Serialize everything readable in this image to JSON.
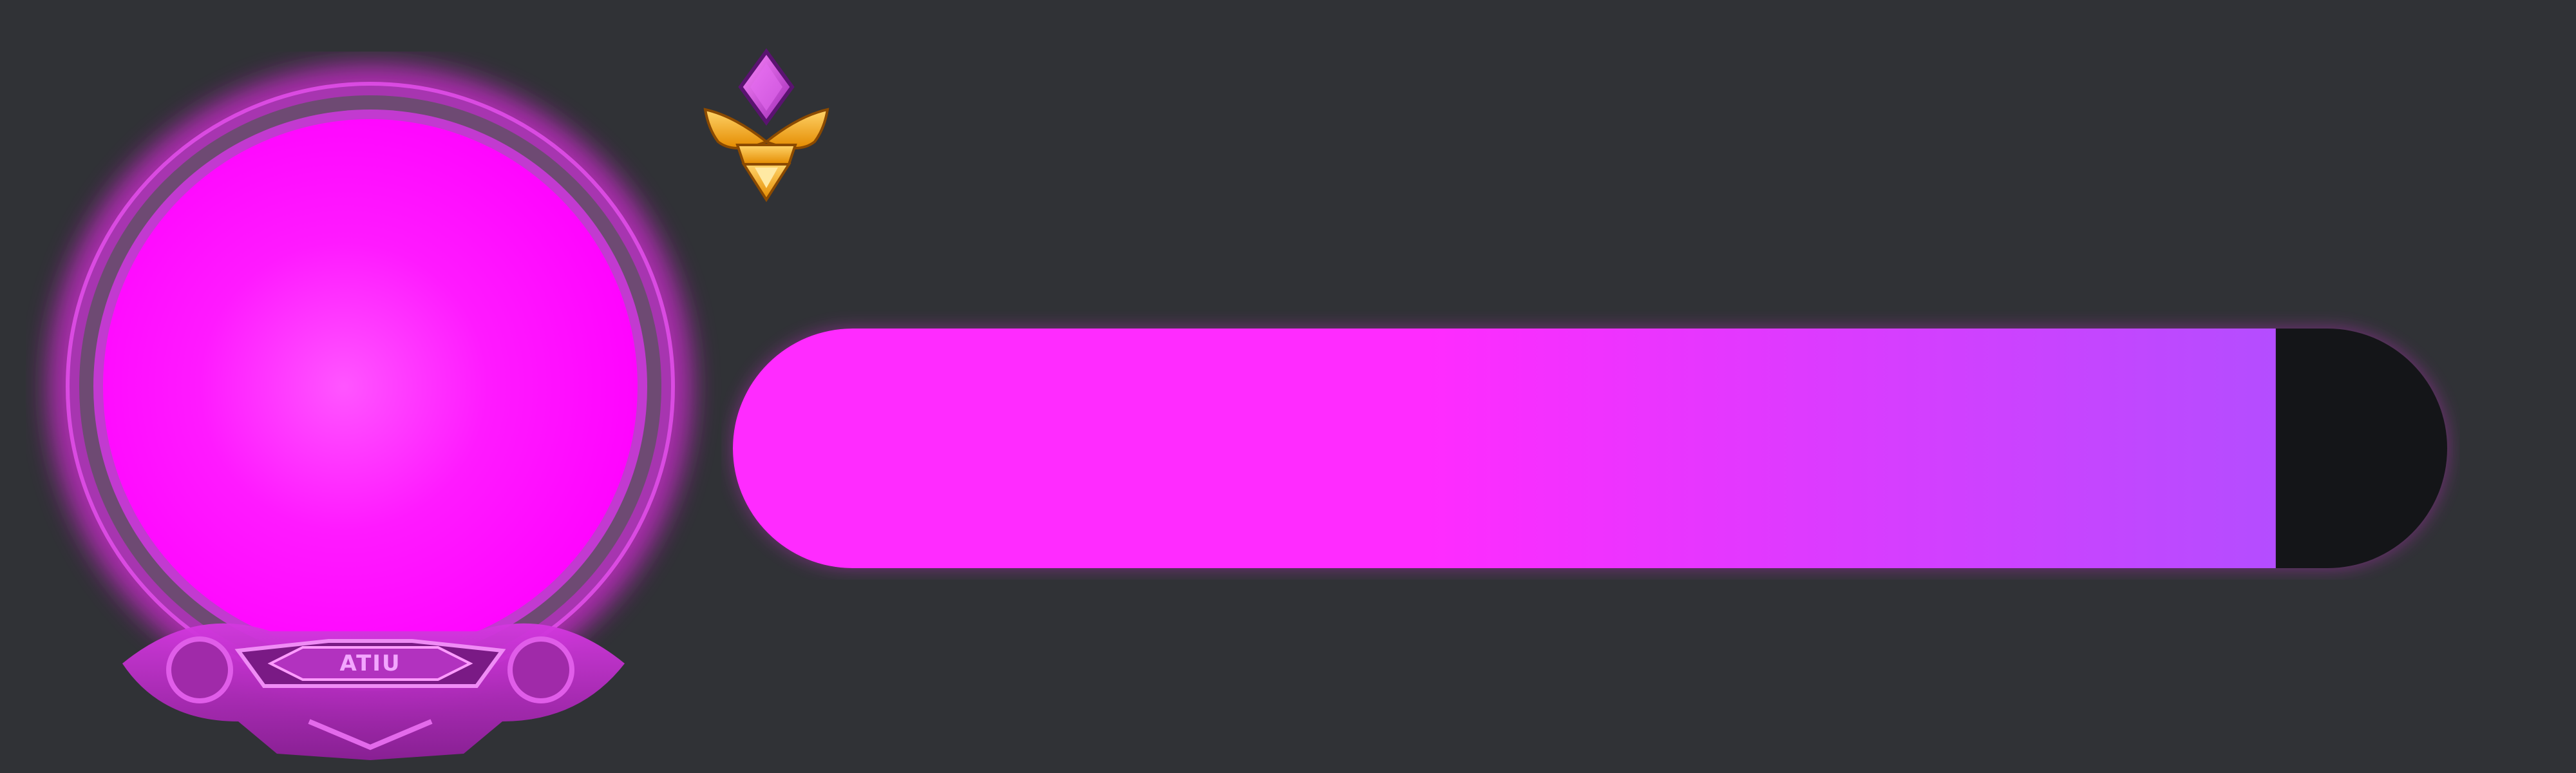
{
  "avatar_frame": {
    "label": "ATIU",
    "glow_color": "#ff1aff",
    "ring_color": "#8a2a8f",
    "portrait_color": "#ff00ff"
  },
  "rank_emblem": {
    "icon": "winged-rank-badge-icon",
    "gem_color": "#c445d6",
    "wing_color": "#ffb11f"
  },
  "progress": {
    "value": 0.9,
    "fill_start": "#ff2bff",
    "fill_end": "#b44dff",
    "track_color": "#141518"
  }
}
